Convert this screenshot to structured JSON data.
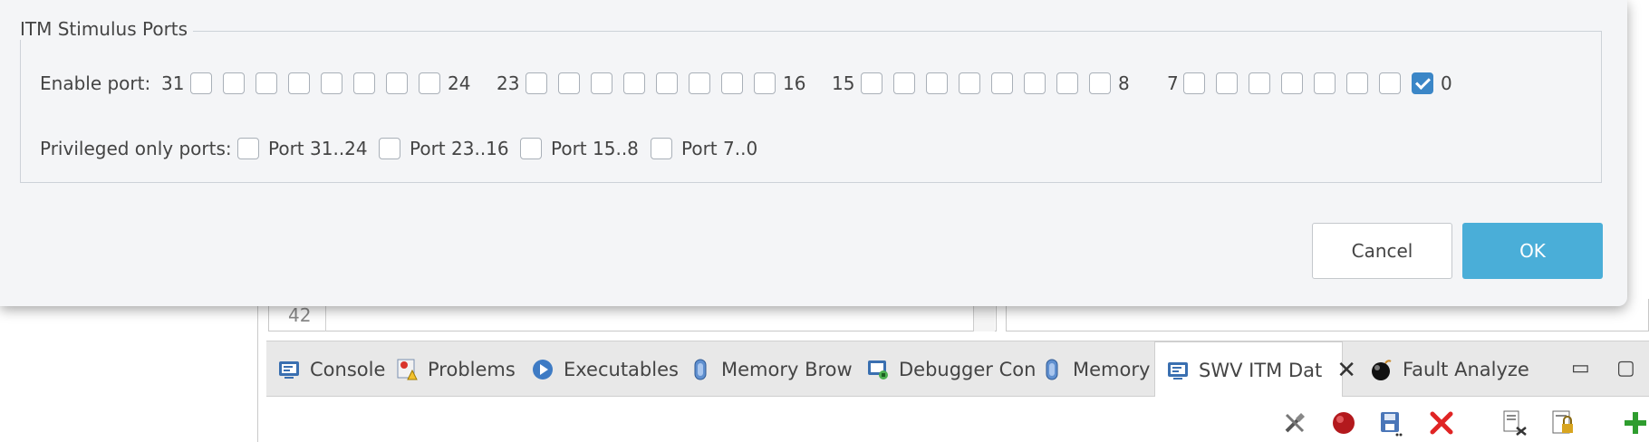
{
  "dialog": {
    "group_title": "ITM Stimulus Ports",
    "enable_label": "Enable port:",
    "port_groups": [
      {
        "high": "31",
        "low": "24",
        "checked": [
          false,
          false,
          false,
          false,
          false,
          false,
          false,
          false
        ]
      },
      {
        "high": "23",
        "low": "16",
        "checked": [
          false,
          false,
          false,
          false,
          false,
          false,
          false,
          false
        ]
      },
      {
        "high": "15",
        "low": "8",
        "checked": [
          false,
          false,
          false,
          false,
          false,
          false,
          false,
          false
        ]
      },
      {
        "high": "7",
        "low": "0",
        "checked": [
          false,
          false,
          false,
          false,
          false,
          false,
          false,
          true
        ]
      }
    ],
    "privileged_label": "Privileged only ports:",
    "privileged_ports": [
      {
        "label": "Port 31..24",
        "checked": false
      },
      {
        "label": "Port 23..16",
        "checked": false
      },
      {
        "label": "Port 15..8",
        "checked": false
      },
      {
        "label": "Port 7..0",
        "checked": false
      }
    ],
    "cancel_label": "Cancel",
    "ok_label": "OK"
  },
  "editor": {
    "line_number": "42"
  },
  "tabs": [
    {
      "label": "Console",
      "icon": "console-icon"
    },
    {
      "label": "Problems",
      "icon": "problems-icon"
    },
    {
      "label": "Executables",
      "icon": "executables-icon"
    },
    {
      "label": "Memory Brow",
      "icon": "memory-browser-icon"
    },
    {
      "label": "Debugger Con",
      "icon": "debugger-console-icon"
    },
    {
      "label": "Memory",
      "icon": "memory-icon"
    },
    {
      "label": "SWV ITM Dat",
      "icon": "swv-itm-icon",
      "active": true
    },
    {
      "label": "Fault Analyze",
      "icon": "fault-analyzer-icon"
    }
  ],
  "view_controls": {
    "minimize": "▭",
    "maximize": "▢"
  },
  "colors": {
    "accent": "#4aaed8",
    "checkbox_checked": "#3b86c7"
  }
}
